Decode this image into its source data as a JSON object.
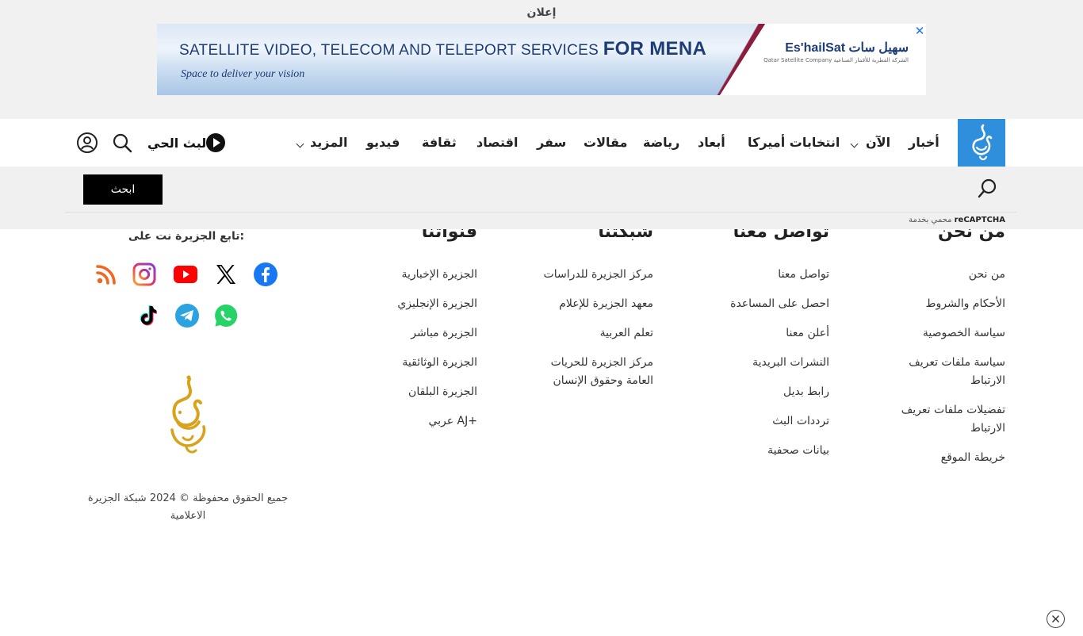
{
  "ad": {
    "label": "إعلان",
    "headline_part1": "SATELLITE VIDEO, TELECOM AND TELEPORT SERVICES",
    "headline_part2": "FOR MENA",
    "tagline": "Space to deliver your vision",
    "brand": "Es'hailSat سهيل سات",
    "brand_sub": "Qatar Satellite Company الشركة القطرية للأقمار الصناعية",
    "close_glyph": "✕"
  },
  "nav": {
    "items": [
      "أخبار",
      "الآن",
      "انتخابات أميركا",
      "أبعاد",
      "رياضة",
      "مقالات",
      "سفر",
      "اقتصاد",
      "ثقافة",
      "فيديو",
      "المزيد"
    ],
    "live_label": "البث الحي",
    "logo_color": "#2f8fdc"
  },
  "search": {
    "input_value": "",
    "button_label": "ابحث",
    "recaptcha_prefix": "محمي بخدمة",
    "recaptcha_brand": "reCAPTCHA"
  },
  "footer": {
    "columns": [
      {
        "heading": "من نحن",
        "links": [
          "من نحن",
          "الأحكام والشروط",
          "سياسة الخصوصية",
          "سياسة ملفات تعريف الارتباط",
          "تفضيلات ملفات تعريف الارتباط",
          "خريطة الموقع"
        ]
      },
      {
        "heading": "تواصل معنا",
        "links": [
          "تواصل معنا",
          "احصل على المساعدة",
          "أعلن معنا",
          "النشرات البريدية",
          "رابط بديل",
          "ترددات البث",
          "بيانات صحفية"
        ]
      },
      {
        "heading": "شبكتنا",
        "links": [
          "مركز الجزيرة للدراسات",
          "معهد الجزيرة للإعلام",
          "تعلم العربية",
          "مركز الجزيرة للحريات العامة وحقوق الإنسان"
        ]
      },
      {
        "heading": "قنواتنا",
        "links": [
          "الجزيرة الإخبارية",
          "الجزيرة الإنجليزي",
          "الجزيرة مباشر",
          "الجزيرة الوثائقية",
          "الجزيرة البلقان",
          "عربي AJ+"
        ]
      }
    ],
    "follow_label": "تابع الجزيرة نت على:",
    "social": [
      {
        "name": "facebook",
        "color": "#1877f2"
      },
      {
        "name": "x",
        "color": "#000000"
      },
      {
        "name": "youtube",
        "color": "#ff0000"
      },
      {
        "name": "instagram",
        "color": "#c13584"
      },
      {
        "name": "rss",
        "color": "#f26522"
      },
      {
        "name": "whatsapp",
        "color": "#25d366"
      },
      {
        "name": "telegram",
        "color": "#2aa3e0"
      },
      {
        "name": "tiktok",
        "color": "#000000"
      }
    ],
    "logo_color": "#d9a21b",
    "copyright": "جميع الحقوق محفوظة © 2024 شبكة الجزيرة الاعلامية"
  }
}
